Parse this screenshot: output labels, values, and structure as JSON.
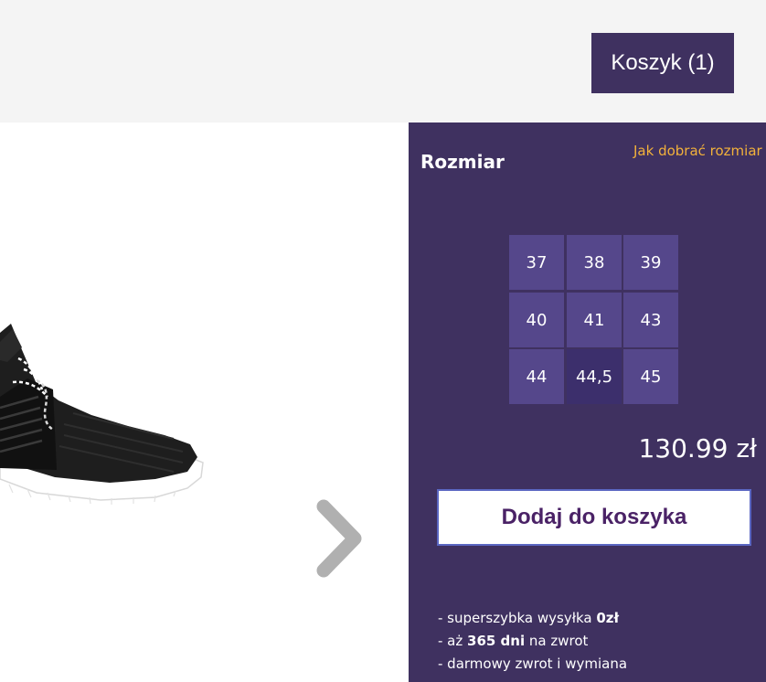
{
  "header": {
    "cart_label": "Koszyk (1)"
  },
  "gallery": {
    "image_icon": "sneaker-image",
    "next_icon": "chevron-right-icon"
  },
  "product": {
    "size_title": "Rozmiar",
    "size_guide_link": "Jak dobrać rozmiar",
    "sizes": [
      "37",
      "38",
      "39",
      "40",
      "41",
      "43",
      "44",
      "44,5",
      "45"
    ],
    "selected_size": "44,5",
    "price": "130.99 zł",
    "add_to_cart_label": "Dodaj do koszyka"
  },
  "benefits": [
    {
      "prefix": "- superszybka wysyłka ",
      "bold": "0zł",
      "suffix": ""
    },
    {
      "prefix": "- aż ",
      "bold": "365 dni",
      "suffix": " na zwrot"
    },
    {
      "prefix": "- darmowy zwrot i wymiana",
      "bold": "",
      "suffix": ""
    }
  ],
  "colors": {
    "panel": "#3f3160",
    "size_tile": "#55478b",
    "size_selected": "#3c2f6c",
    "accent_link": "#f2b13b",
    "button_text": "#4a2266"
  }
}
